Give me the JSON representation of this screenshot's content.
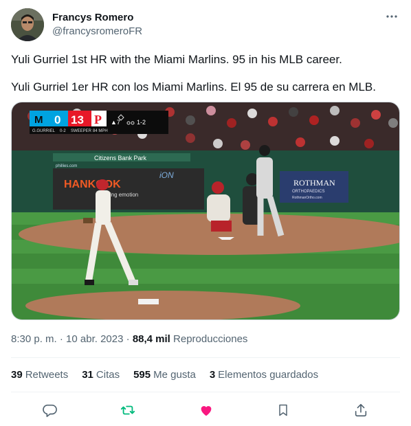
{
  "author": {
    "display_name": "Francys Romero",
    "handle": "@francysromeroFR"
  },
  "tweet": {
    "text_en": "Yuli Gurriel 1st HR with the Miami Marlins. 95 in his MLB career.",
    "text_es": "Yuli Gurriel 1er HR con los Miami Marlins. El 95 de su carrera en MLB."
  },
  "media": {
    "scorebug": {
      "away_score": "0",
      "home_score": "13",
      "batter": "G.GURRIEL",
      "count": "0-2",
      "pitch_type": "SWEEPER",
      "pitch_speed": "84 MPH",
      "inning": "▲7",
      "outs_count": "1-2"
    },
    "ad_citizens": "Citizens Bank Park",
    "ad_hankook": "HANKOOK",
    "ad_hankook_sub": "driving emotion",
    "ad_ion": "iON",
    "ad_rothman": "ROTHMAN",
    "ad_rothman_sub": "ORTHOPAEDICS",
    "ad_rothman_url": "RothmanOrtho.com",
    "ad_phillies": "phillies.com"
  },
  "meta": {
    "time": "8:30 p. m.",
    "separator": "·",
    "date": "10 abr. 2023",
    "views_count": "88,4 mil",
    "views_label": "Reproducciones"
  },
  "stats": {
    "retweets_count": "39",
    "retweets_label": "Retweets",
    "quotes_count": "31",
    "quotes_label": "Citas",
    "likes_count": "595",
    "likes_label": "Me gusta",
    "bookmarks_count": "3",
    "bookmarks_label": "Elementos guardados"
  },
  "colors": {
    "like_active": "#f91880",
    "retweet_active": "#00ba7c",
    "icon_gray": "#536471",
    "text_dark": "#0f1419"
  },
  "icons": {
    "more": "more-dots-icon",
    "reply": "reply-icon",
    "retweet": "retweet-icon",
    "like": "heart-icon",
    "bookmark": "bookmark-icon",
    "share": "share-icon"
  }
}
